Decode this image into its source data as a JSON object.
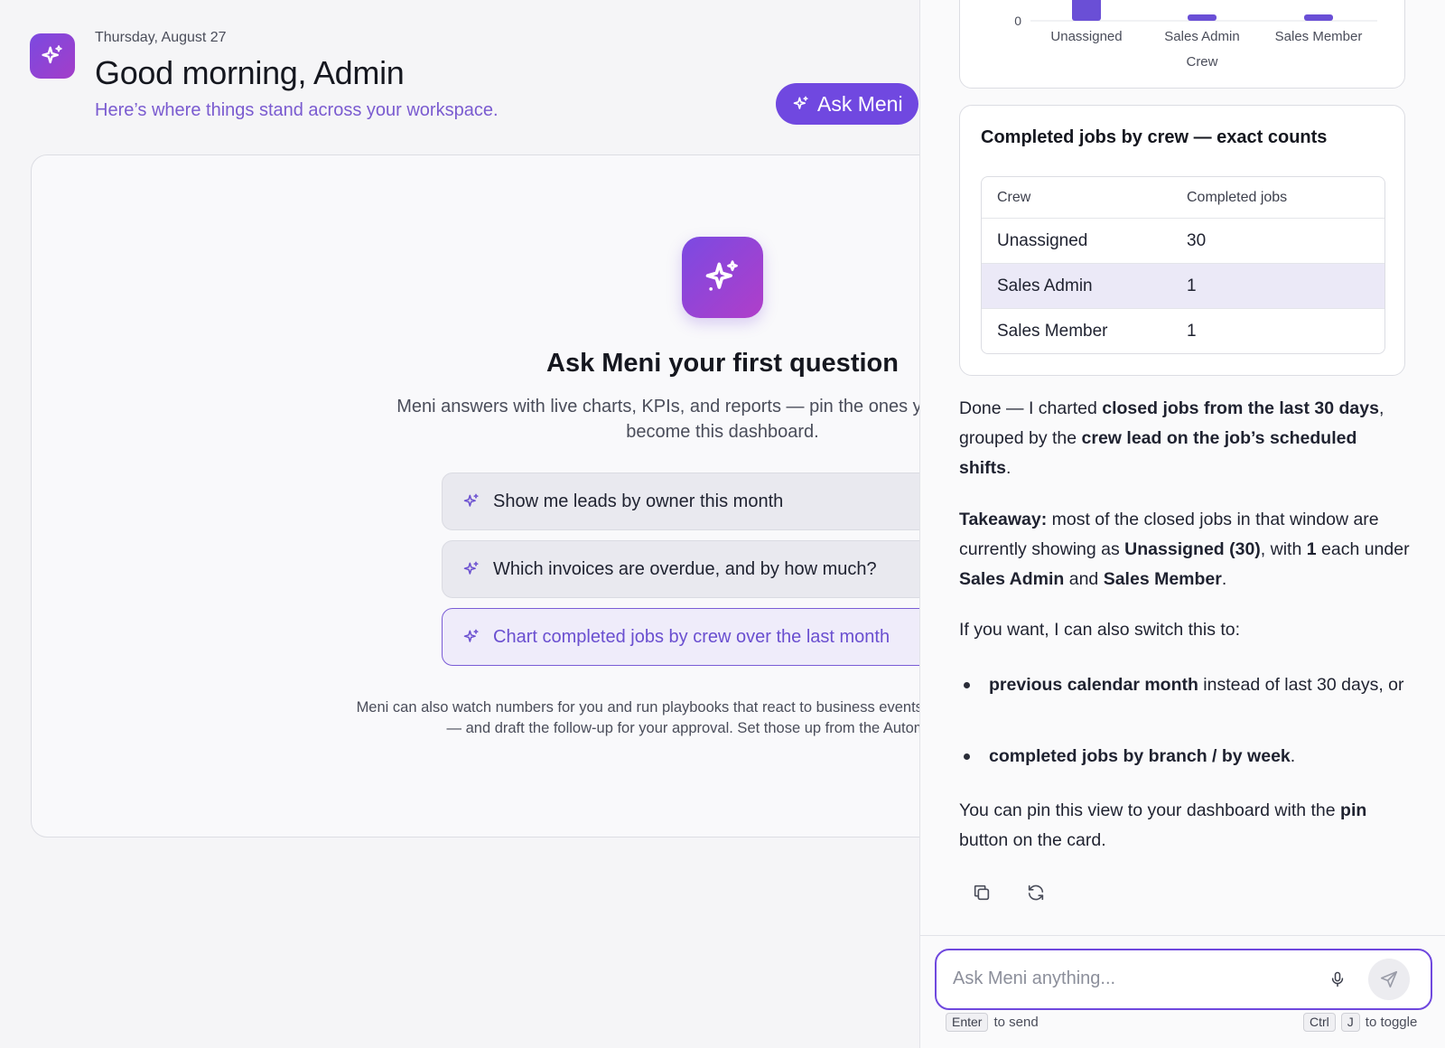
{
  "header": {
    "date": "Thursday, August 27",
    "greeting": "Good morning, Admin",
    "subtitle": "Here’s where things stand across your workspace.",
    "ask_button": "Ask Meni"
  },
  "empty_state": {
    "title": "Ask Meni your first question",
    "description": "Meni answers with live charts, KPIs, and reports — pin the ones you like and they become this dashboard.",
    "suggestions": [
      "Show me leads by owner this month",
      "Which invoices are overdue, and by how much?",
      "Chart completed jobs by crew over the last month"
    ],
    "footnote": "Meni can also watch numbers for you and run playbooks that react to business events — like an overdue invoice — and draft the follow-up for your approval. Set those up from the Automations page."
  },
  "chart_data": {
    "type": "bar",
    "categories": [
      "Unassigned",
      "Sales Admin",
      "Sales Member"
    ],
    "values": [
      30,
      1,
      1
    ],
    "xlabel": "Crew",
    "ylabel": "",
    "y_ticks_visible": [
      "0"
    ],
    "color": "#6a4fd6"
  },
  "table": {
    "title": "Completed jobs by crew — exact counts",
    "columns": [
      "Crew",
      "Completed jobs"
    ],
    "rows": [
      [
        "Unassigned",
        "30"
      ],
      [
        "Sales Admin",
        "1"
      ],
      [
        "Sales Member",
        "1"
      ]
    ]
  },
  "message": {
    "p1": {
      "a": "Done — I charted ",
      "b": "closed jobs from the last 30 days",
      "c": ", grouped by the ",
      "d": "crew lead on the job’s scheduled shifts",
      "e": "."
    },
    "p2": {
      "a": "Takeaway:",
      "b": " most of the closed jobs in that window are currently showing as ",
      "c": "Unassigned (30)",
      "d": ", with ",
      "e": "1",
      "f": " each under ",
      "g": "Sales Admin",
      "h": " and ",
      "i": "Sales Member",
      "j": "."
    },
    "p3": "If you want, I can also switch this to:",
    "bullet1": {
      "a": "previous calendar month",
      "b": " instead of last 30 days, or"
    },
    "bullet2": {
      "a": "completed jobs by branch / by week",
      "b": "."
    },
    "p4": {
      "a": "You can pin this view to your dashboard with the ",
      "b": "pin",
      "c": " button on the card."
    }
  },
  "composer": {
    "placeholder": "Ask Meni anything...",
    "hint_send_key": "Enter",
    "hint_send": "to send",
    "hint_toggle_key1": "Ctrl",
    "hint_toggle_key2": "J",
    "hint_toggle": "to toggle"
  },
  "icons": {
    "brand": "sparkle-icon",
    "copy": "copy-icon",
    "regenerate": "refresh-icon",
    "mic": "microphone-icon",
    "send": "send-icon"
  },
  "colors": {
    "accent": "#7048e0",
    "accent_text": "#7a5bd0",
    "highlight_row": "#ebe9f7"
  }
}
